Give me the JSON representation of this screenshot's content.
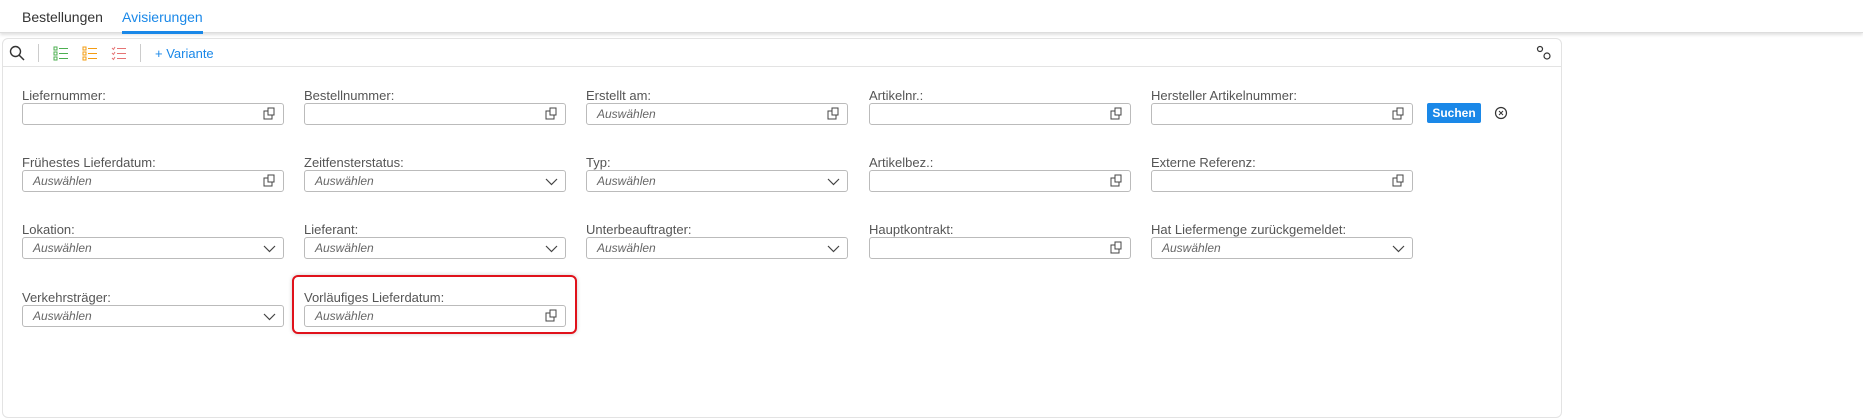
{
  "tabs": [
    {
      "label": "Bestellungen",
      "active": false
    },
    {
      "label": "Avisierungen",
      "active": true
    }
  ],
  "toolbar": {
    "variant_label": "+ Variante",
    "icons": [
      "search-icon",
      "list-green-icon",
      "list-orange-icon",
      "checklist-red-icon",
      "settings-gears-icon"
    ]
  },
  "search_button": "Suchen",
  "placeholder": "Auswählen",
  "fields": [
    {
      "label": "Liefernummer:",
      "value": "",
      "type": "value-help"
    },
    {
      "label": "Bestellnummer:",
      "value": "",
      "type": "value-help"
    },
    {
      "label": "Erstellt am:",
      "placeholder": "Auswählen",
      "type": "value-help"
    },
    {
      "label": "Artikelnr.:",
      "value": "",
      "type": "value-help"
    },
    {
      "label": "Hersteller Artikelnummer:",
      "value": "",
      "type": "value-help"
    },
    {
      "label": "Frühestes Lieferdatum:",
      "placeholder": "Auswählen",
      "type": "value-help"
    },
    {
      "label": "Zeitfensterstatus:",
      "placeholder": "Auswählen",
      "type": "dropdown"
    },
    {
      "label": "Typ:",
      "placeholder": "Auswählen",
      "type": "dropdown"
    },
    {
      "label": "Artikelbez.:",
      "value": "",
      "type": "value-help"
    },
    {
      "label": "Externe Referenz:",
      "value": "",
      "type": "value-help"
    },
    {
      "label": "Lokation:",
      "placeholder": "Auswählen",
      "type": "dropdown"
    },
    {
      "label": "Lieferant:",
      "placeholder": "Auswählen",
      "type": "dropdown"
    },
    {
      "label": "Unterbeauftragter:",
      "placeholder": "Auswählen",
      "type": "dropdown"
    },
    {
      "label": "Hauptkontrakt:",
      "value": "",
      "type": "value-help"
    },
    {
      "label": "Hat Liefermenge zurückgemeldet:",
      "placeholder": "Auswählen",
      "type": "dropdown"
    },
    {
      "label": "Verkehrsträger:",
      "placeholder": "Auswählen",
      "type": "dropdown"
    },
    {
      "label": "Vorläufiges Lieferdatum:",
      "placeholder": "Auswählen",
      "type": "value-help",
      "highlighted": true
    }
  ],
  "colors": {
    "accent": "#1a88e8",
    "highlight": "#e0121b"
  }
}
